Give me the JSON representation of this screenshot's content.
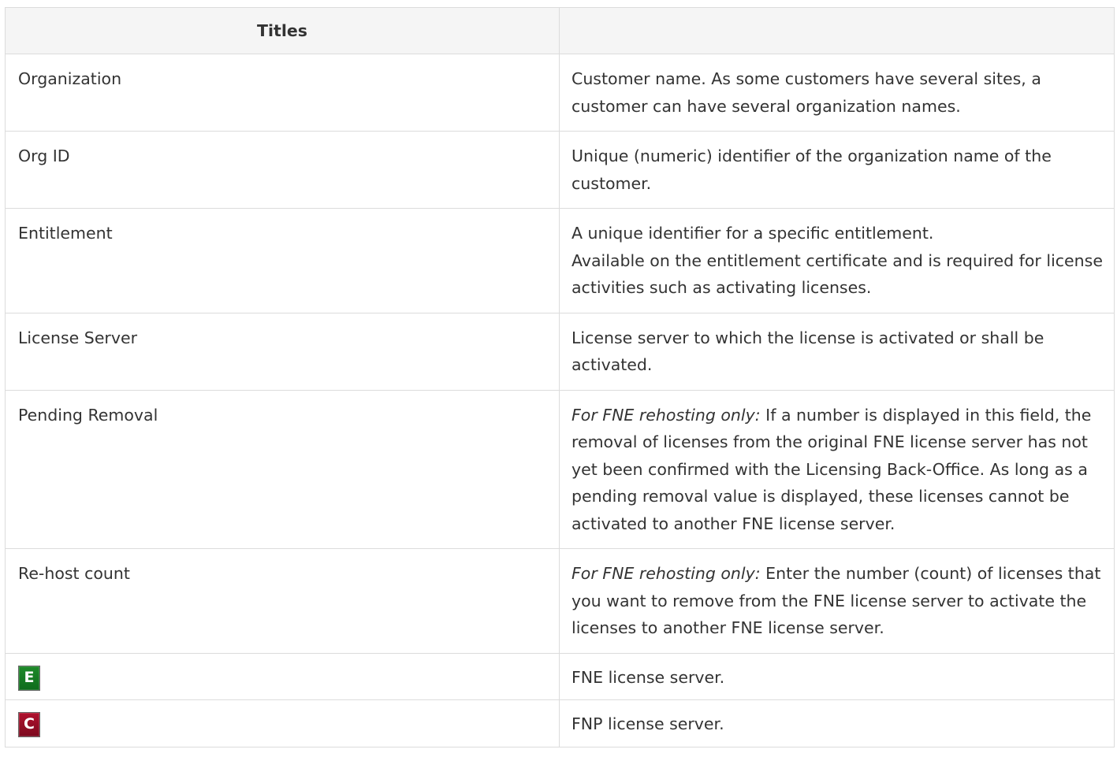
{
  "table": {
    "header": [
      "Titles",
      ""
    ],
    "rows": [
      {
        "title": "Organization",
        "desc": "Customer name. As some customers have several sites, a customer can have several organization names."
      },
      {
        "title": "Org ID",
        "desc": "Unique (numeric) identifier of the organization name of the customer."
      },
      {
        "title": "Entitlement",
        "desc_line1": "A unique identifier for a specific entitlement.",
        "desc_line2": "Available on the entitlement certificate and is required for license activities such as activating licenses."
      },
      {
        "title": "License Server",
        "desc": "License server to which the license is activated or shall be activated."
      },
      {
        "title": "Pending Removal",
        "desc_em": "For FNE rehosting only:",
        "desc": " If a number is displayed in this field, the removal of licenses from the original FNE license server has not yet been confirmed with the Licensing Back-Office. As long as a pending removal value is displayed, these licenses cannot be activated to another FNE license server."
      },
      {
        "title": "Re-host count",
        "desc_em": "For FNE rehosting only:",
        "desc": " Enter the number (count) of licenses that you want to remove from the FNE license server to activate the licenses to another FNE license server."
      },
      {
        "icon": "fne-server-icon",
        "icon_letter": "E",
        "icon_color": "#138024",
        "desc": "FNE license server."
      },
      {
        "icon": "fnp-server-icon",
        "icon_letter": "C",
        "icon_color": "#9a0f28",
        "desc": "FNP license server."
      }
    ]
  }
}
